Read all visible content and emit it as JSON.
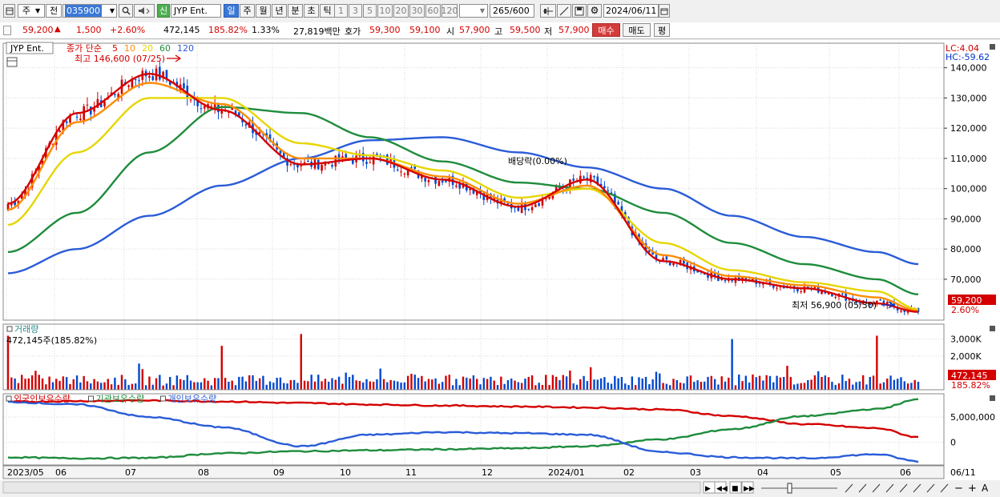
{
  "toolbar": {
    "period_unit": "주",
    "prev_label": "전",
    "code": "035900",
    "new_badge": "신",
    "stock_name": "JYP Ent.",
    "period_buttons": [
      "일",
      "주",
      "월",
      "년",
      "분",
      "초",
      "틱"
    ],
    "selected_period": "일",
    "n_buttons": [
      "1",
      "3",
      "5",
      "10",
      "20",
      "30",
      "60",
      "120"
    ],
    "count": "265",
    "count_total": "/600",
    "date": "2024/06/11"
  },
  "quote": {
    "price": "59,200",
    "change": "1,500",
    "change_pct": "+2.60%",
    "volume": "472,145",
    "volume_ratio": "185.82%",
    "turnover": "1.33%",
    "amount": "27,819백만",
    "ask_label": "호가",
    "ask": "59,300",
    "bid": "59,100",
    "open_label": "시",
    "open": "57,900",
    "high_label": "고",
    "high": "59,500",
    "low_label": "저",
    "low": "57,900",
    "buy_label": "매수",
    "sell_label": "매도",
    "eval_label": "평"
  },
  "price_panel": {
    "stock_tag": "JYP Ent.",
    "legend_prefix": "종가 단순",
    "ma_labels": [
      {
        "label": "5",
        "color": "#d40000"
      },
      {
        "label": "10",
        "color": "#ff8c00"
      },
      {
        "label": "20",
        "color": "#e6d600"
      },
      {
        "label": "60",
        "color": "#1e8c3c"
      },
      {
        "label": "120",
        "color": "#2a5cd8"
      }
    ],
    "high_note": "최고 146,600 (07/25)",
    "low_note": "최저 56,900 (05/30)",
    "event_note": "배당락(0.00%)",
    "lc": "LC:4.04",
    "hc": "HC:-59.62",
    "current_price_tag": "59,200",
    "current_pct_tag": "2.60%"
  },
  "volume_panel": {
    "title": "거래량",
    "value_note": "472,145주(185.82%)",
    "current_tag": "472,145",
    "current_pct_tag": "185.82%"
  },
  "holdings_panel": {
    "legend": [
      {
        "label": "외국인보유수량",
        "color": "#d40000"
      },
      {
        "label": "기관보유수량",
        "color": "#1e8c3c"
      },
      {
        "label": "개인보유수량",
        "color": "#2a5cd8"
      }
    ]
  },
  "colors": {
    "up": "#d40000",
    "down": "#0048d0"
  },
  "chart_data": [
    {
      "type": "line",
      "title": "",
      "note": "price panel: candlesticks with moving averages; y axis in KRW",
      "x_axis_labels": [
        "2023/05",
        "06",
        "07",
        "08",
        "09",
        "10",
        "11",
        "12",
        "2024/01",
        "02",
        "03",
        "04",
        "05",
        "06",
        "06/11"
      ],
      "y_ticks": [
        70000,
        80000,
        90000,
        100000,
        110000,
        120000,
        130000,
        140000
      ],
      "y_tick_labels": [
        "70,000",
        "80,000",
        "90,000",
        "100,000",
        "110,000",
        "120,000",
        "130,000",
        "140,000"
      ],
      "ylim": [
        57000,
        146000
      ],
      "grid": true,
      "months": [
        "2023/05",
        "06",
        "07",
        "08",
        "09",
        "10",
        "11",
        "12",
        "2024/01",
        "02",
        "03",
        "04",
        "05",
        "06"
      ],
      "series": [
        {
          "name": "5",
          "approx_monthly_close": [
            95000,
            125000,
            138000,
            126000,
            108000,
            110000,
            103000,
            94000,
            103000,
            76000,
            70000,
            67000,
            62000,
            59200
          ]
        },
        {
          "name": "10",
          "approx_monthly_close": [
            93000,
            122000,
            135000,
            128000,
            110000,
            110000,
            104000,
            95000,
            101000,
            78000,
            71000,
            68000,
            64000,
            59500
          ]
        },
        {
          "name": "20",
          "approx_monthly_close": [
            88000,
            112000,
            130000,
            130000,
            115000,
            111000,
            106000,
            97000,
            100000,
            82000,
            73000,
            69000,
            66000,
            60000
          ]
        },
        {
          "name": "60",
          "approx_monthly_close": [
            79000,
            92000,
            112000,
            127000,
            125000,
            117000,
            109000,
            102000,
            100000,
            92000,
            82000,
            75000,
            70000,
            65000
          ]
        },
        {
          "name": "120",
          "approx_monthly_close": [
            72000,
            80000,
            91000,
            101000,
            110000,
            116000,
            117000,
            112000,
            107000,
            100000,
            91000,
            84000,
            79000,
            75000
          ]
        }
      ]
    },
    {
      "type": "bar",
      "title": "",
      "note": "volume panel",
      "y_tick_labels": [
        "2,000K",
        "3,000K"
      ],
      "spikes_approx": [
        {
          "x": "2023/05",
          "value": 3200000
        },
        {
          "x": "08",
          "value": 2600000
        },
        {
          "x": "09",
          "value": 3300000
        },
        {
          "x": "03",
          "value": 3000000
        },
        {
          "x": "05",
          "value": 3200000
        }
      ],
      "last_value": 472145
    },
    {
      "type": "line",
      "title": "",
      "note": "holdings panel",
      "y_tick_labels": [
        "0",
        "5,000,000"
      ],
      "series": [
        {
          "name": "외국인보유수량",
          "approx_monthly": [
            8000000,
            8200000,
            8300000,
            8100000,
            7800000,
            7500000,
            7300000,
            7100000,
            6900000,
            6500000,
            5200000,
            3600000,
            2800000,
            1000000
          ]
        },
        {
          "name": "기관보유수량",
          "approx_monthly": [
            -3000000,
            -3200000,
            -3100000,
            -2200000,
            -1800000,
            -1600000,
            -1400000,
            -1200000,
            -800000,
            600000,
            2600000,
            5200000,
            6600000,
            8500000
          ]
        },
        {
          "name": "개인보유수량",
          "approx_monthly": [
            8000000,
            7500000,
            5000000,
            3000000,
            -800000,
            1500000,
            2000000,
            1800000,
            1500000,
            -2000000,
            -3000000,
            -3200000,
            -2400000,
            -3800000
          ]
        }
      ]
    }
  ]
}
